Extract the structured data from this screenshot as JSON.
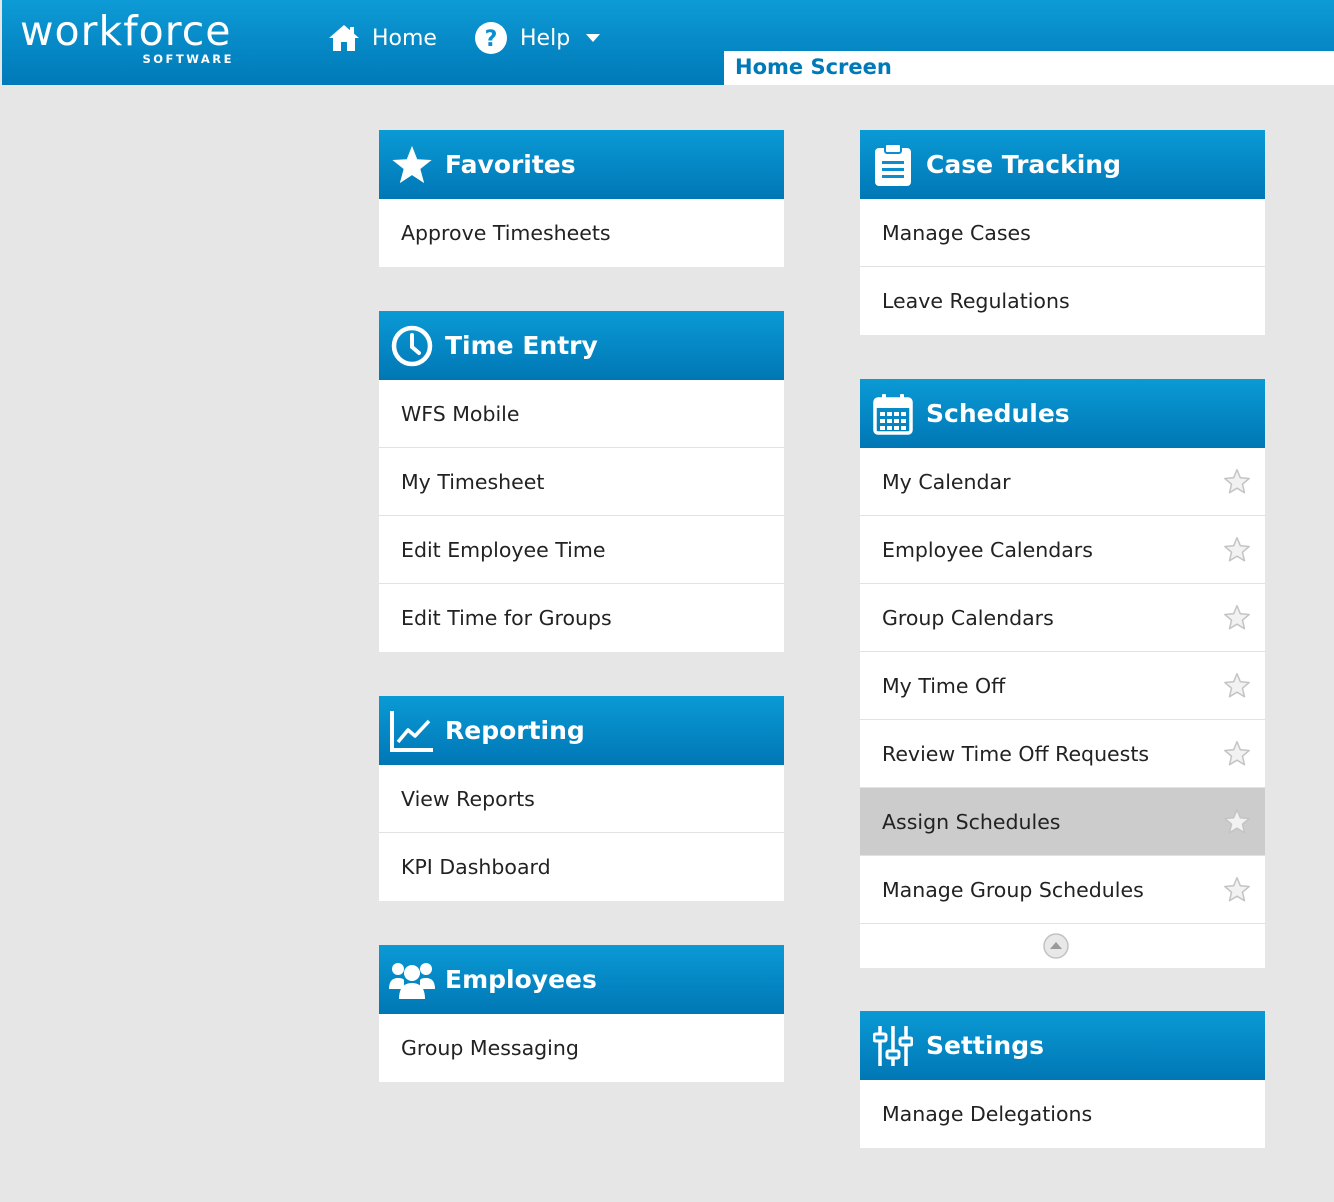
{
  "logo": {
    "main": "workforce",
    "sub": "SOFTWARE"
  },
  "nav": {
    "home_label": "Home",
    "help_label": "Help"
  },
  "breadcrumb": "Home Screen",
  "colors": {
    "header_blue": "#0a8fce",
    "active_row": "#cccccc",
    "page_bg": "#e6e6e6"
  },
  "panels": {
    "favorites": {
      "title": "Favorites",
      "icon": "star-icon",
      "items": [
        "Approve Timesheets"
      ]
    },
    "time_entry": {
      "title": "Time Entry",
      "icon": "clock-icon",
      "items": [
        "WFS Mobile",
        "My Timesheet",
        "Edit Employee Time",
        "Edit Time for Groups"
      ]
    },
    "reporting": {
      "title": "Reporting",
      "icon": "chart-icon",
      "items": [
        "View Reports",
        "KPI Dashboard"
      ]
    },
    "employees": {
      "title": "Employees",
      "icon": "users-icon",
      "items": [
        "Group Messaging"
      ]
    },
    "case_tracking": {
      "title": "Case Tracking",
      "icon": "clipboard-icon",
      "items": [
        "Manage Cases",
        "Leave Regulations"
      ]
    },
    "schedules": {
      "title": "Schedules",
      "icon": "calendar-icon",
      "items": [
        "My Calendar",
        "Employee Calendars",
        "Group Calendars",
        "My Time Off",
        "Review Time Off Requests",
        "Assign Schedules",
        "Manage Group Schedules"
      ],
      "active_item": "Assign Schedules"
    },
    "settings": {
      "title": "Settings",
      "icon": "sliders-icon",
      "items": [
        "Manage Delegations"
      ]
    }
  }
}
